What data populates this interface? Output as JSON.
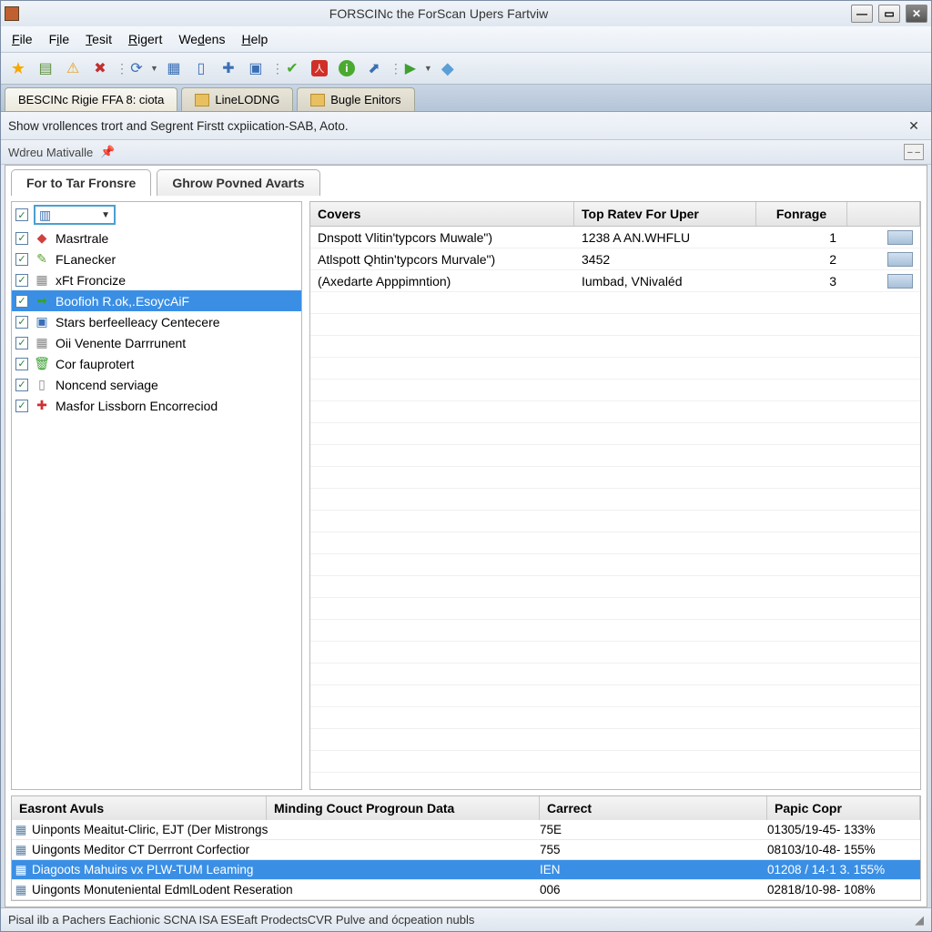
{
  "title": "FORSCINc the ForScan Upers Fartviw",
  "menubar": [
    "File",
    "File",
    "Tesit",
    "Rigert",
    "Wedens",
    "Help"
  ],
  "tabs": [
    {
      "label": "BESCINc Rigie FFA 8: ciota"
    },
    {
      "label": "LineLODNG"
    },
    {
      "label": "Bugle Enitors"
    }
  ],
  "subbar_text": "Show vrollences trort and Segrent Firstt cxpiication-SAB, Aoto.",
  "subbar2_label": "Wdreu Mativalle",
  "inner_tabs": [
    "For to Tar Fronsre",
    "Ghrow Povned Avarts"
  ],
  "left_items": [
    {
      "label": "",
      "dropdown": true
    },
    {
      "label": "Masrtrale"
    },
    {
      "label": "FLanecker"
    },
    {
      "label": "xFt Froncize"
    },
    {
      "label": "Boofioh R.ok,.EsoycAiF",
      "selected": true
    },
    {
      "label": "Stars berfeelleacy Centecere"
    },
    {
      "label": "Oii Venente Darrrunent"
    },
    {
      "label": "Cor fauprotert"
    },
    {
      "label": "Noncend serviage"
    },
    {
      "label": "Masfor Lissborn Encorreciod"
    }
  ],
  "grid_headers": [
    "Covers",
    "Top Ratev For Uper",
    "Fonrage"
  ],
  "grid_rows": [
    {
      "c1": "Dnspott Vlitin'typcors Muwale\")",
      "c2": "1238 A AN.WHFLU",
      "c3": "1"
    },
    {
      "c1": "Atlspott Qhtin'typcors Murvale\")",
      "c2": "3452",
      "c3": "2"
    },
    {
      "c1": "(Axedarte Apppimntion)",
      "c2": "Iumbad, VNivaléd",
      "c3": "3"
    }
  ],
  "bottom_headers": [
    "Easront Avuls",
    "Minding Couct Progroun Data",
    "Carrect",
    "Papic Copr"
  ],
  "bottom_rows": [
    {
      "c1": "Uinponts Meaitut-Cliric, EJT (Der Mistrongs",
      "c2": "75E",
      "c3": "01305/19-45- 133%"
    },
    {
      "c1": "Uingonts Meditor CT Derrront Corfectior",
      "c2": "755",
      "c3": "08103/10-48- 155%"
    },
    {
      "c1": "Diagoots Mahuirs vx PLW-TUM Leaming",
      "c2": "IEN",
      "c3": "01208 / 14·1 3. 155%",
      "selected": true
    },
    {
      "c1": "Uingonts Monuteniental EdmlLodent Reseration",
      "c2": "006",
      "c3": "02818/10-98- 108%"
    }
  ],
  "status_text": "Pisal ilb a Pachers Eachionic SCNA ISA ESEaft ProdectsCVR Pulve and ócpeation nubls"
}
